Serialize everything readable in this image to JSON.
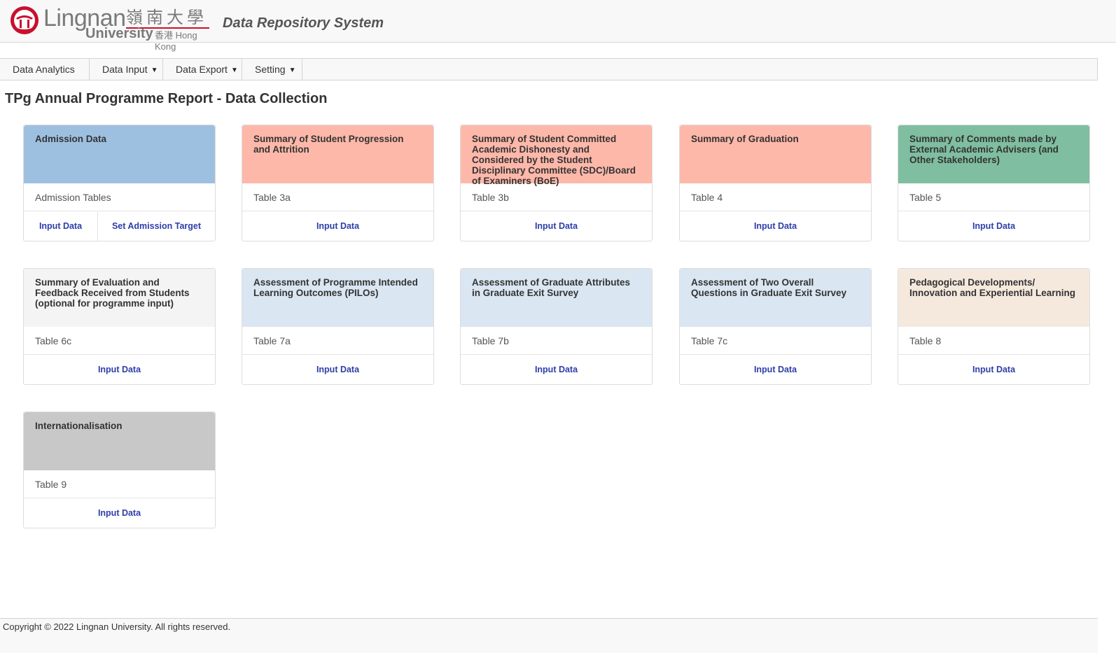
{
  "header": {
    "logo": {
      "en": "Lingnan",
      "cn": "嶺南大學",
      "univ": "University",
      "hk": "香港 Hong Kong"
    },
    "system_title": "Data Repository System"
  },
  "nav": {
    "items": [
      {
        "label": "Data Analytics",
        "dropdown": false
      },
      {
        "label": "Data Input",
        "dropdown": true
      },
      {
        "label": "Data Export",
        "dropdown": true
      },
      {
        "label": "Setting",
        "dropdown": true
      }
    ],
    "caret": "▼"
  },
  "page": {
    "title": "TPg Annual Programme Report - Data Collection"
  },
  "cards": [
    {
      "title": "Admission Data",
      "table": "Admission Tables",
      "actions": [
        "Input Data",
        "Set Admission Target"
      ],
      "color": "#9ec0e0"
    },
    {
      "title": "Summary of Student Progression and Attrition",
      "table": "Table 3a",
      "actions": [
        "Input Data"
      ],
      "color": "#fdb8aa"
    },
    {
      "title": "Summary of Student Committed Academic Dishonesty and Considered by the Student Disciplinary Committee (SDC)/Board of Examiners (BoE)",
      "table": "Table 3b",
      "actions": [
        "Input Data"
      ],
      "color": "#fdb8aa"
    },
    {
      "title": "Summary of Graduation",
      "table": "Table 4",
      "actions": [
        "Input Data"
      ],
      "color": "#fdb8aa"
    },
    {
      "title": "Summary of Comments made by External Academic Advisers (and Other Stakeholders)",
      "table": "Table 5",
      "actions": [
        "Input Data"
      ],
      "color": "#7fbea0"
    },
    {
      "title": "Summary of Evaluation and Feedback Received from Students (optional for programme input)",
      "table": "Table 6c",
      "actions": [
        "Input Data"
      ],
      "color": "#f4f4f4"
    },
    {
      "title": "Assessment of Programme Intended Learning Outcomes (PILOs)",
      "table": "Table 7a",
      "actions": [
        "Input Data"
      ],
      "color": "#dae6f2"
    },
    {
      "title": "Assessment of Graduate Attributes in Graduate Exit Survey",
      "table": "Table 7b",
      "actions": [
        "Input Data"
      ],
      "color": "#dae6f2"
    },
    {
      "title": "Assessment of Two Overall Questions in Graduate Exit Survey",
      "table": "Table 7c",
      "actions": [
        "Input Data"
      ],
      "color": "#dae6f2"
    },
    {
      "title": "Pedagogical Developments/ Innovation and Experiential Learning",
      "table": "Table 8",
      "actions": [
        "Input Data"
      ],
      "color": "#f5e9de"
    },
    {
      "title": "Internationalisation",
      "table": "Table 9",
      "actions": [
        "Input Data"
      ],
      "color": "#c8c8c8"
    }
  ],
  "footer": {
    "copyright": "Copyright © 2022 Lingnan University. All rights reserved."
  }
}
